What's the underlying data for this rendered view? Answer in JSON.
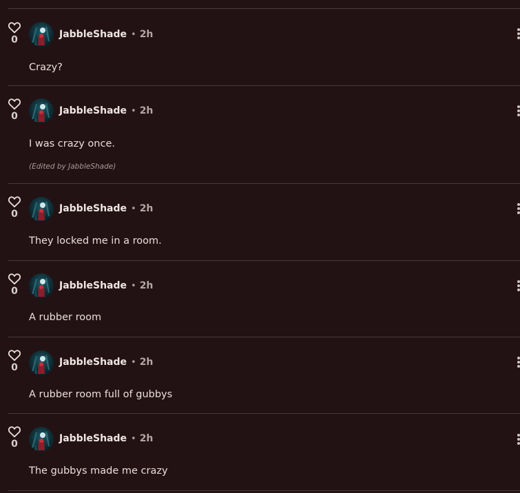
{
  "posts": [
    {
      "username": "JabbleShade",
      "separator": "•",
      "timestamp": "2h",
      "body": "Crazy?",
      "likes": "0",
      "edited": ""
    },
    {
      "username": "JabbleShade",
      "separator": "•",
      "timestamp": "2h",
      "body": "I was crazy once.",
      "likes": "0",
      "edited": "(Edited by JabbleShade)"
    },
    {
      "username": "JabbleShade",
      "separator": "•",
      "timestamp": "2h",
      "body": "They locked me in a room.",
      "likes": "0",
      "edited": ""
    },
    {
      "username": "JabbleShade",
      "separator": "•",
      "timestamp": "2h",
      "body": "A rubber room",
      "likes": "0",
      "edited": ""
    },
    {
      "username": "JabbleShade",
      "separator": "•",
      "timestamp": "2h",
      "body": "A rubber room full of gubbys",
      "likes": "0",
      "edited": ""
    },
    {
      "username": "JabbleShade",
      "separator": "•",
      "timestamp": "2h",
      "body": "The gubbys made me crazy",
      "likes": "0",
      "edited": ""
    }
  ],
  "icons": {
    "like": "heart-icon",
    "menu": "kebab-menu-icon",
    "avatar": "avatar"
  },
  "colors": {
    "background": "#231214",
    "divider": "#4a3a3b",
    "text": "#e9dfdc",
    "muted": "#a89c9a"
  }
}
